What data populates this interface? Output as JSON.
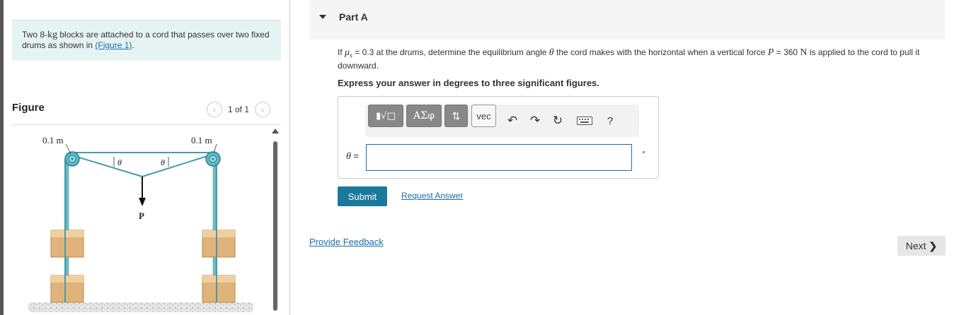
{
  "problem": {
    "intro_prefix": "Two 8-",
    "intro_unit": "kg",
    "intro_mid": " blocks are attached to a cord that passes over two fixed drums as shown in ",
    "figure_link": "(Figure 1)",
    "intro_suffix": "."
  },
  "figure_panel": {
    "title": "Figure",
    "counter": "1 of 1",
    "prev_icon": "chevron-left",
    "next_icon": "chevron-right",
    "labels": {
      "left_radius": "0.1 m",
      "right_radius": "0.1 m",
      "angle_left": "θ",
      "angle_right": "θ",
      "force": "P"
    }
  },
  "part": {
    "title": "Part A",
    "question_prefix": "If ",
    "mu": "μ",
    "mu_sub": "s",
    "question_mid1": " = 0.3 at the drums, determine the equilibrium angle ",
    "theta": "θ",
    "question_mid2": " the cord makes with the horizontal when a vertical force ",
    "force_symbol": "P",
    "question_mid3": " = 360 ",
    "force_unit": "N",
    "question_suffix": " is applied to the cord to pull it downward.",
    "instruction": "Express your answer in degrees to three significant figures."
  },
  "answer": {
    "toolbar": {
      "templates_icon": "radical-template-icon",
      "greek_label": "ΑΣφ",
      "sort_icon": "up-down-arrows-icon",
      "vec_label": "vec",
      "undo_icon": "undo-icon",
      "redo_icon": "redo-icon",
      "reset_icon": "reset-icon",
      "keyboard_icon": "keyboard-icon",
      "help_label": "?"
    },
    "variable_label": "θ",
    "equals": " =",
    "value": "",
    "unit": "°"
  },
  "actions": {
    "submit_label": "Submit",
    "request_answer_label": "Request Answer",
    "feedback_label": "Provide Feedback",
    "next_label": "Next"
  },
  "colors": {
    "accent": "#1a7a9e",
    "link": "#1a6ea8",
    "intro_bg": "#e6f3f3",
    "drum": "#5bb9c9",
    "block": "#e0b37a"
  }
}
